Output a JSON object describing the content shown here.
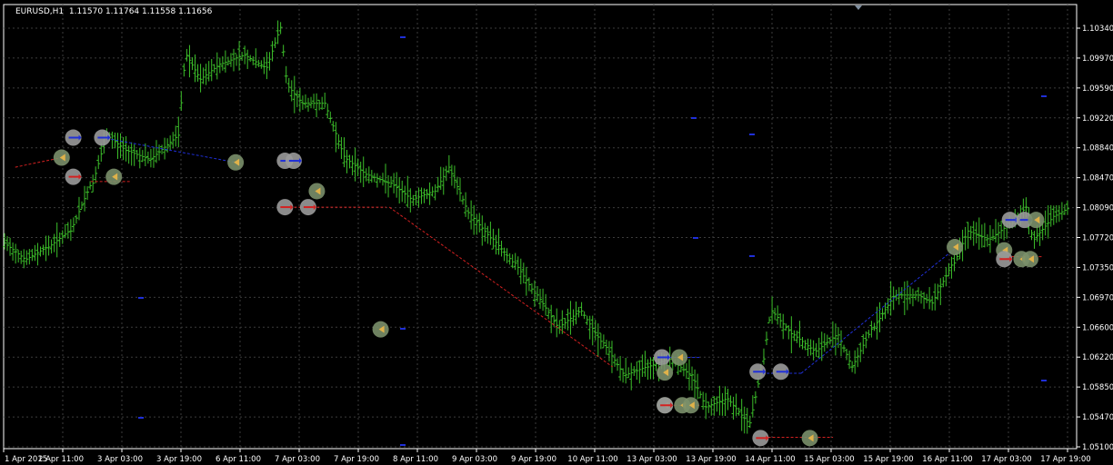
{
  "chart_header": {
    "symbol": "EURUSD,H1",
    "ohlc": "1.11570 1.11764 1.11558 1.11656"
  },
  "colors": {
    "background": "#000000",
    "grid": "#3c3c3c",
    "axis": "#ffffff",
    "bar": "#3cbf2a",
    "buy_line": "#1f2fd8",
    "sell_line": "#d42121",
    "marker_bg": "#9a9a9a",
    "arrow_close": "#e0b24a"
  },
  "chart_data": {
    "type": "ohlc",
    "symbol": "EURUSD",
    "timeframe": "H1",
    "price_axis": {
      "labels": [
        "1.10340",
        "1.09970",
        "1.09590",
        "1.09220",
        "1.08840",
        "1.08470",
        "1.08090",
        "1.07720",
        "1.07350",
        "1.06970",
        "1.06600",
        "1.06220",
        "1.05850",
        "1.05470",
        "1.05100"
      ],
      "ylim": [
        1.051,
        1.1034
      ]
    },
    "time_axis": {
      "labels": [
        "1 Apr 2015",
        "2 Apr 11:00",
        "3 Apr 03:00",
        "3 Apr 19:00",
        "6 Apr 11:00",
        "7 Apr 03:00",
        "7 Apr 19:00",
        "8 Apr 11:00",
        "9 Apr 03:00",
        "9 Apr 19:00",
        "10 Apr 11:00",
        "13 Apr 03:00",
        "13 Apr 19:00",
        "14 Apr 11:00",
        "15 Apr 03:00",
        "15 Apr 19:00",
        "16 Apr 11:00",
        "17 Apr 03:00",
        "17 Apr 19:00"
      ]
    },
    "price_path": [
      [
        1.0765,
        0
      ],
      [
        1.0745,
        3
      ],
      [
        1.076,
        6
      ],
      [
        1.078,
        9
      ],
      [
        1.084,
        12
      ],
      [
        1.09,
        14
      ],
      [
        1.088,
        17
      ],
      [
        1.087,
        20
      ],
      [
        1.0885,
        22
      ],
      [
        1.09,
        24
      ],
      [
        1.1,
        25
      ],
      [
        1.097,
        27
      ],
      [
        1.099,
        30
      ],
      [
        1.1,
        33
      ],
      [
        1.0985,
        36
      ],
      [
        1.1035,
        38
      ],
      [
        1.096,
        39
      ],
      [
        1.094,
        41
      ],
      [
        1.094,
        44
      ],
      [
        1.087,
        47
      ],
      [
        1.085,
        50
      ],
      [
        1.084,
        53
      ],
      [
        1.082,
        56
      ],
      [
        1.083,
        59
      ],
      [
        1.086,
        61
      ],
      [
        1.08,
        64
      ],
      [
        1.077,
        67
      ],
      [
        1.074,
        70
      ],
      [
        1.07,
        73
      ],
      [
        1.066,
        76
      ],
      [
        1.068,
        79
      ],
      [
        1.064,
        82
      ],
      [
        1.06,
        85
      ],
      [
        1.061,
        88
      ],
      [
        1.062,
        91
      ],
      [
        1.06,
        94
      ],
      [
        1.056,
        96
      ],
      [
        1.057,
        99
      ],
      [
        1.054,
        102
      ],
      [
        1.062,
        104
      ],
      [
        1.068,
        105
      ],
      [
        1.065,
        108
      ],
      [
        1.063,
        111
      ],
      [
        1.065,
        114
      ],
      [
        1.061,
        116
      ],
      [
        1.066,
        119
      ],
      [
        1.07,
        122
      ],
      [
        1.07,
        125
      ],
      [
        1.069,
        127
      ],
      [
        1.074,
        130
      ],
      [
        1.078,
        132
      ],
      [
        1.077,
        135
      ],
      [
        1.079,
        138
      ],
      [
        1.081,
        140
      ],
      [
        1.077,
        141
      ],
      [
        1.08,
        144
      ],
      [
        1.081,
        146
      ]
    ],
    "trade_lines": [
      {
        "side": "sell",
        "from": [
          4,
          1.086
        ],
        "to": [
          20,
          1.0872
        ]
      },
      {
        "side": "buy",
        "from": [
          34,
          1.0897
        ],
        "to": [
          80,
          1.0866
        ]
      },
      {
        "side": "sell",
        "from": [
          30,
          1.0842
        ],
        "to": [
          44,
          1.0842
        ]
      },
      {
        "side": "sell",
        "from": [
          97,
          1.081
        ],
        "to": [
          132,
          1.081
        ]
      },
      {
        "side": "sell",
        "from": [
          133,
          1.081
        ],
        "to": [
          210,
          1.061
        ]
      },
      {
        "side": "buy",
        "from": [
          228,
          1.0622
        ],
        "to": [
          240,
          1.0622
        ]
      },
      {
        "side": "sell",
        "from": [
          228,
          1.0562
        ],
        "to": [
          240,
          1.0562
        ]
      },
      {
        "side": "buy",
        "from": [
          260,
          1.0602
        ],
        "to": [
          275,
          1.0602
        ]
      },
      {
        "side": "buy",
        "from": [
          275,
          1.0602
        ],
        "to": [
          328,
          1.0758
        ]
      },
      {
        "side": "sell",
        "from": [
          262,
          1.0522
        ],
        "to": [
          286,
          1.0522
        ]
      },
      {
        "side": "buy",
        "from": [
          346,
          1.0792
        ],
        "to": [
          358,
          1.0792
        ]
      },
      {
        "side": "sell",
        "from": [
          346,
          1.0748
        ],
        "to": [
          358,
          1.0748
        ]
      }
    ],
    "markers": [
      {
        "type": "buy-open",
        "x": 24,
        "price": 1.0897
      },
      {
        "type": "buy-open",
        "x": 34,
        "price": 1.0897
      },
      {
        "type": "close",
        "x": 20,
        "price": 1.0872
      },
      {
        "type": "sell-open",
        "x": 24,
        "price": 1.0848
      },
      {
        "type": "close",
        "x": 38,
        "price": 1.0848
      },
      {
        "type": "close",
        "x": 80,
        "price": 1.0866
      },
      {
        "type": "buy-open",
        "x": 97,
        "price": 1.0868
      },
      {
        "type": "buy-open",
        "x": 100,
        "price": 1.0868
      },
      {
        "type": "close",
        "x": 108,
        "price": 1.083
      },
      {
        "type": "sell-open",
        "x": 97,
        "price": 1.081
      },
      {
        "type": "sell-open",
        "x": 105,
        "price": 1.081
      },
      {
        "type": "close",
        "x": 130,
        "price": 1.0657
      },
      {
        "type": "buy-open",
        "x": 227,
        "price": 1.0622
      },
      {
        "type": "close",
        "x": 233,
        "price": 1.0622
      },
      {
        "type": "close",
        "x": 228,
        "price": 1.0603
      },
      {
        "type": "close",
        "x": 228,
        "price": 1.0562
      },
      {
        "type": "sell-open",
        "x": 228,
        "price": 1.0562
      },
      {
        "type": "close",
        "x": 234,
        "price": 1.0562
      },
      {
        "type": "close",
        "x": 237,
        "price": 1.0562
      },
      {
        "type": "buy-open",
        "x": 260,
        "price": 1.0604
      },
      {
        "type": "buy-open",
        "x": 268,
        "price": 1.0604
      },
      {
        "type": "sell-open",
        "x": 261,
        "price": 1.0521
      },
      {
        "type": "close",
        "x": 278,
        "price": 1.0521
      },
      {
        "type": "close",
        "x": 328,
        "price": 1.076
      },
      {
        "type": "buy-open",
        "x": 347,
        "price": 1.0794
      },
      {
        "type": "buy-open",
        "x": 352,
        "price": 1.0794
      },
      {
        "type": "close",
        "x": 356,
        "price": 1.0794
      },
      {
        "type": "close",
        "x": 345,
        "price": 1.0756
      },
      {
        "type": "sell-open",
        "x": 345,
        "price": 1.0745
      },
      {
        "type": "close",
        "x": 351,
        "price": 1.0745
      },
      {
        "type": "close",
        "x": 354,
        "price": 1.0745
      }
    ]
  }
}
